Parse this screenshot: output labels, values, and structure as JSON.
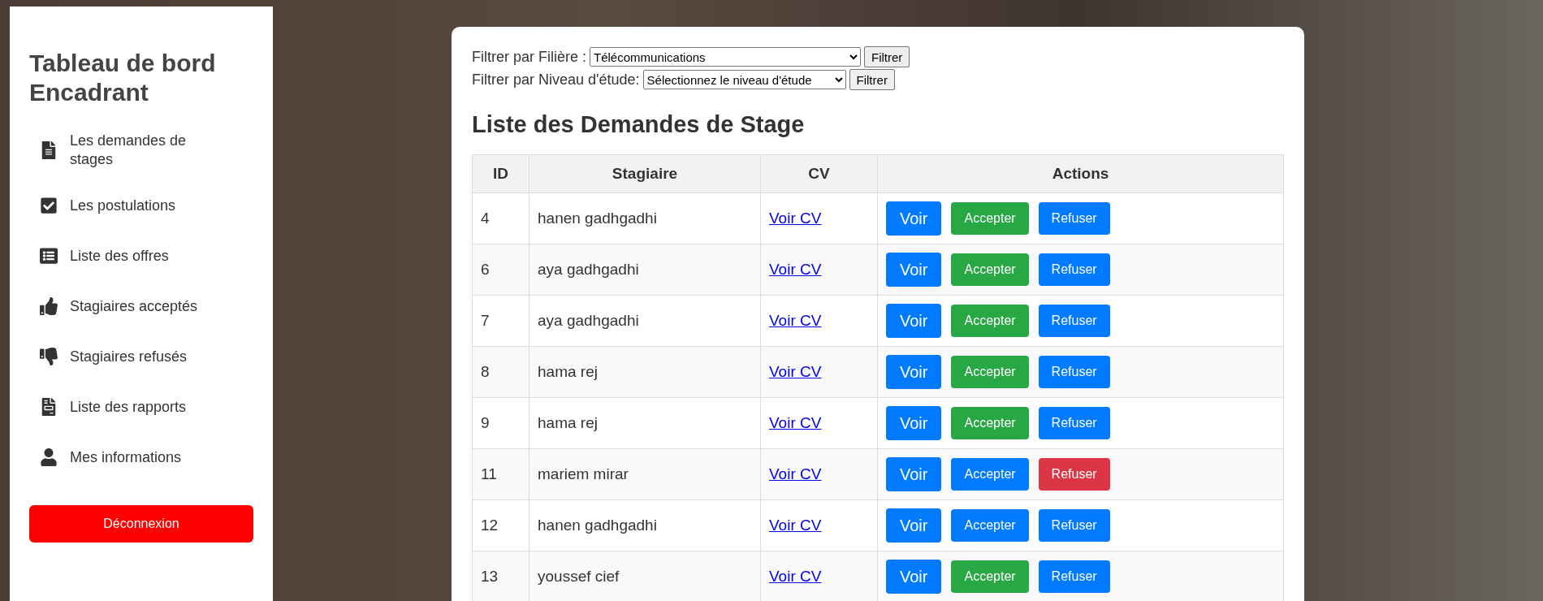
{
  "sidebar": {
    "title": "Tableau de bord Encadrant",
    "items": [
      {
        "label": "Les demandes de stages"
      },
      {
        "label": "Les postulations"
      },
      {
        "label": "Liste des offres"
      },
      {
        "label": "Stagiaires acceptés"
      },
      {
        "label": "Stagiaires refusés"
      },
      {
        "label": "Liste des rapports"
      },
      {
        "label": "Mes informations"
      }
    ],
    "logout": "Déconnexion"
  },
  "filters": [
    {
      "label": "Filtrer par Filière :",
      "value": "Télécommunications",
      "button": "Filtrer"
    },
    {
      "label": "Filtrer par Niveau d'étude:",
      "value": "Sélectionnez le niveau d'étude",
      "button": "Filtrer"
    }
  ],
  "heading": "Liste des Demandes de Stage",
  "table": {
    "columns": [
      "ID",
      "Stagiaire",
      "CV",
      "Actions"
    ],
    "rows": [
      {
        "id": "4",
        "name": "hanen gadhgadhi",
        "cv": "Voir CV",
        "view": "Voir",
        "accept": "Accepter",
        "refuse": "Refuser",
        "accepted": true,
        "refused": false
      },
      {
        "id": "6",
        "name": "aya gadhgadhi",
        "cv": "Voir CV",
        "view": "Voir",
        "accept": "Accepter",
        "refuse": "Refuser",
        "accepted": true,
        "refused": false
      },
      {
        "id": "7",
        "name": "aya gadhgadhi",
        "cv": "Voir CV",
        "view": "Voir",
        "accept": "Accepter",
        "refuse": "Refuser",
        "accepted": true,
        "refused": false
      },
      {
        "id": "8",
        "name": "hama rej",
        "cv": "Voir CV",
        "view": "Voir",
        "accept": "Accepter",
        "refuse": "Refuser",
        "accepted": true,
        "refused": false
      },
      {
        "id": "9",
        "name": "hama rej",
        "cv": "Voir CV",
        "view": "Voir",
        "accept": "Accepter",
        "refuse": "Refuser",
        "accepted": true,
        "refused": false
      },
      {
        "id": "11",
        "name": "mariem mirar",
        "cv": "Voir CV",
        "view": "Voir",
        "accept": "Accepter",
        "refuse": "Refuser",
        "accepted": false,
        "refused": true
      },
      {
        "id": "12",
        "name": "hanen gadhgadhi",
        "cv": "Voir CV",
        "view": "Voir",
        "accept": "Accepter",
        "refuse": "Refuser",
        "accepted": false,
        "refused": false
      },
      {
        "id": "13",
        "name": "youssef cief",
        "cv": "Voir CV",
        "view": "Voir",
        "accept": "Accepter",
        "refuse": "Refuser",
        "accepted": true,
        "refused": false
      }
    ]
  }
}
